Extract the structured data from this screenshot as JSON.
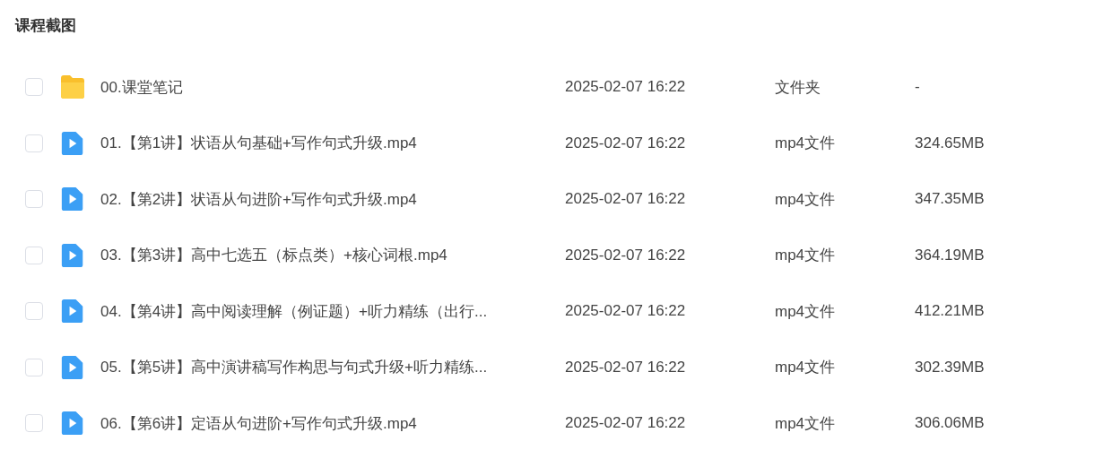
{
  "title": "课程截图",
  "files": [
    {
      "kind": "folder",
      "checked": false,
      "name": "00.课堂笔记",
      "modified": "2025-02-07 16:22",
      "type": "文件夹",
      "size": "-"
    },
    {
      "kind": "video",
      "checked": false,
      "name": "01.【第1讲】状语从句基础+写作句式升级.mp4",
      "modified": "2025-02-07 16:22",
      "type": "mp4文件",
      "size": "324.65MB"
    },
    {
      "kind": "video",
      "checked": false,
      "name": "02.【第2讲】状语从句进阶+写作句式升级.mp4",
      "modified": "2025-02-07 16:22",
      "type": "mp4文件",
      "size": "347.35MB"
    },
    {
      "kind": "video",
      "checked": false,
      "name": "03.【第3讲】高中七选五（标点类）+核心词根.mp4",
      "modified": "2025-02-07 16:22",
      "type": "mp4文件",
      "size": "364.19MB"
    },
    {
      "kind": "video",
      "checked": false,
      "name": "04.【第4讲】高中阅读理解（例证题）+听力精练（出行...",
      "modified": "2025-02-07 16:22",
      "type": "mp4文件",
      "size": "412.21MB"
    },
    {
      "kind": "video",
      "checked": false,
      "name": "05.【第5讲】高中演讲稿写作构思与句式升级+听力精练...",
      "modified": "2025-02-07 16:22",
      "type": "mp4文件",
      "size": "302.39MB"
    },
    {
      "kind": "video",
      "checked": false,
      "name": "06.【第6讲】定语从句进阶+写作句式升级.mp4",
      "modified": "2025-02-07 16:22",
      "type": "mp4文件",
      "size": "306.06MB"
    }
  ]
}
